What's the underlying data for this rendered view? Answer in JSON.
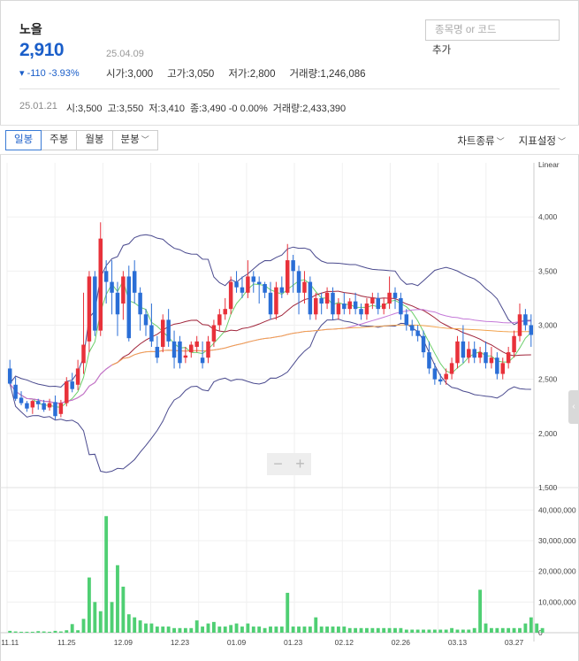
{
  "stock": {
    "name": "노을",
    "price": "2,910",
    "date": "25.04.09",
    "change": "▾ -110 -3.93%",
    "stats": [
      {
        "label": "시가",
        "value": "3,000"
      },
      {
        "label": "고가",
        "value": "3,050"
      },
      {
        "label": "저가",
        "value": "2,800"
      },
      {
        "label": "거래량",
        "value": "1,246,086"
      }
    ]
  },
  "search": {
    "placeholder": "종목명 or 코드",
    "add_label": "추가"
  },
  "previous": {
    "date": "25.01.21",
    "items": [
      {
        "label": "시",
        "value": "3,500"
      },
      {
        "label": "고",
        "value": "3,550"
      },
      {
        "label": "저",
        "value": "3,410"
      },
      {
        "label": "종",
        "value": "3,490 -0 0.00%"
      },
      {
        "label": "거래량",
        "value": "2,433,390"
      }
    ]
  },
  "toolbar": {
    "tabs": [
      "일봉",
      "주봉",
      "월봉",
      "분봉"
    ],
    "active_tab": 0,
    "chart_type_label": "차트종류",
    "indicator_label": "지표설정"
  },
  "colors": {
    "up": "#e8313a",
    "down": "#2a6ed6",
    "volume": "#4fcf73",
    "bollinger": "#4a4a8e",
    "ma_short": "#6bcf6b",
    "ma_mid": "#a0243a",
    "ma_long": "#c478d8",
    "ma_xlong": "#f2a24c"
  },
  "chart_data": {
    "type": "candlestick",
    "scale_label": "Linear",
    "price_ticks": [
      4000,
      3500,
      3000,
      2500,
      2000,
      1500
    ],
    "price_tick_labels": [
      "4,000",
      "3,500",
      "3,000",
      "2,500",
      "2,000",
      "1,500"
    ],
    "volume_ticks": [
      0,
      10000000,
      20000000,
      30000000,
      40000000
    ],
    "volume_tick_labels": [
      "0",
      "10,000,000",
      "20,000,000",
      "30,000,000",
      "40,000,000"
    ],
    "x_labels": [
      "11.11",
      "11.25",
      "12.09",
      "12.23",
      "01.09",
      "01.23",
      "02.12",
      "02.26",
      "03.13",
      "03.27"
    ],
    "x_label_index": [
      0,
      10,
      20,
      30,
      40,
      50,
      59,
      69,
      79,
      89
    ],
    "candles": [
      [
        2600,
        2680,
        2460,
        2450
      ],
      [
        2450,
        2520,
        2320,
        2300
      ],
      [
        2330,
        2390,
        2280,
        2260
      ],
      [
        2280,
        2300,
        2230,
        2200
      ],
      [
        2240,
        2310,
        2300,
        2180
      ],
      [
        2300,
        2320,
        2270,
        2220
      ],
      [
        2280,
        2310,
        2220,
        2200
      ],
      [
        2240,
        2320,
        2280,
        2210
      ],
      [
        2290,
        2350,
        2160,
        2130
      ],
      [
        2180,
        2310,
        2280,
        2150
      ],
      [
        2280,
        2520,
        2480,
        2250
      ],
      [
        2480,
        2560,
        2410,
        2380
      ],
      [
        2450,
        2680,
        2600,
        2400
      ],
      [
        2650,
        3300,
        2820,
        2550
      ],
      [
        2850,
        3500,
        3450,
        2750
      ],
      [
        3450,
        3500,
        2950,
        2900
      ],
      [
        2950,
        3950,
        3800,
        2900
      ],
      [
        3500,
        3600,
        3400,
        3200
      ],
      [
        3400,
        3600,
        3300,
        3100
      ],
      [
        3300,
        3400,
        3100,
        2900
      ],
      [
        3200,
        3500,
        3450,
        3050
      ],
      [
        3450,
        3550,
        2880,
        2850
      ],
      [
        3500,
        3600,
        3300,
        3200
      ],
      [
        3300,
        3350,
        3100,
        2950
      ],
      [
        3100,
        3150,
        3000,
        2900
      ],
      [
        3000,
        3200,
        2850,
        2800
      ],
      [
        2800,
        2900,
        2700,
        2650
      ],
      [
        2800,
        3100,
        3050,
        2750
      ],
      [
        3050,
        3150,
        2850,
        2800
      ],
      [
        2850,
        2950,
        2700,
        2600
      ],
      [
        2850,
        2900,
        2650,
        2600
      ],
      [
        2700,
        2800,
        2720,
        2650
      ],
      [
        2750,
        2850,
        2820,
        2700
      ],
      [
        2800,
        2900,
        2850,
        2750
      ],
      [
        2700,
        2850,
        2650,
        2600
      ],
      [
        2700,
        2900,
        2850,
        2650
      ],
      [
        2850,
        3050,
        3000,
        2800
      ],
      [
        3000,
        3150,
        3100,
        2950
      ],
      [
        3100,
        3250,
        3150,
        3050
      ],
      [
        3150,
        3450,
        3400,
        3100
      ],
      [
        3400,
        3500,
        3350,
        3300
      ],
      [
        3350,
        3450,
        3300,
        3250
      ],
      [
        3300,
        3600,
        3450,
        3250
      ],
      [
        3450,
        3500,
        3400,
        3300
      ],
      [
        3400,
        3450,
        3380,
        3200
      ],
      [
        3380,
        3400,
        3300,
        3250
      ],
      [
        3300,
        3400,
        3100,
        3050
      ],
      [
        3100,
        3400,
        3350,
        3050
      ],
      [
        3350,
        3450,
        3300,
        3250
      ],
      [
        3300,
        3750,
        3600,
        3280
      ],
      [
        3600,
        3650,
        3500,
        3300
      ],
      [
        3500,
        3550,
        3300,
        3100
      ],
      [
        3300,
        3500,
        3400,
        3200
      ],
      [
        3400,
        3450,
        3100,
        3050
      ],
      [
        3100,
        3300,
        3250,
        3050
      ],
      [
        3250,
        3300,
        3200,
        3100
      ],
      [
        3200,
        3350,
        3300,
        3150
      ],
      [
        3300,
        3350,
        3100,
        3050
      ],
      [
        3100,
        3250,
        3200,
        3050
      ],
      [
        3200,
        3300,
        3150,
        3100
      ],
      [
        3150,
        3250,
        3220,
        3100
      ],
      [
        3220,
        3300,
        3150,
        3100
      ],
      [
        3150,
        3200,
        3100,
        3050
      ],
      [
        3100,
        3250,
        3200,
        3050
      ],
      [
        3200,
        3300,
        3250,
        3150
      ],
      [
        3250,
        3300,
        3150,
        3100
      ],
      [
        3150,
        3250,
        3200,
        3100
      ],
      [
        3200,
        3450,
        3300,
        3150
      ],
      [
        3300,
        3350,
        3250,
        3150
      ],
      [
        3250,
        3300,
        3100,
        3050
      ],
      [
        3100,
        3150,
        3000,
        2950
      ],
      [
        3000,
        3050,
        2950,
        2900
      ],
      [
        2950,
        3000,
        2900,
        2850
      ],
      [
        2900,
        2950,
        2750,
        2700
      ],
      [
        2750,
        2850,
        2600,
        2550
      ],
      [
        2600,
        2650,
        2500,
        2450
      ],
      [
        2500,
        2550,
        2480,
        2450
      ],
      [
        2500,
        2600,
        2550,
        2450
      ],
      [
        2550,
        2700,
        2650,
        2500
      ],
      [
        2650,
        2900,
        2850,
        2600
      ],
      [
        2850,
        3000,
        2700,
        2650
      ],
      [
        2700,
        2850,
        2780,
        2650
      ],
      [
        2780,
        2850,
        2700,
        2650
      ],
      [
        2700,
        2800,
        2750,
        2650
      ],
      [
        2750,
        2850,
        2650,
        2600
      ],
      [
        2650,
        2800,
        2700,
        2600
      ],
      [
        2700,
        2750,
        2550,
        2500
      ],
      [
        2550,
        2700,
        2650,
        2500
      ],
      [
        2650,
        2800,
        2750,
        2600
      ],
      [
        2750,
        2950,
        2900,
        2700
      ],
      [
        2900,
        3200,
        3100,
        2850
      ],
      [
        3100,
        3150,
        3000,
        2950
      ],
      [
        3000,
        3100,
        2910,
        2800
      ]
    ],
    "volumes": [
      0.6,
      0.4,
      0.3,
      0.3,
      0.3,
      0.5,
      0.4,
      0.3,
      0.6,
      0.4,
      0.8,
      2.8,
      0.8,
      4.5,
      18,
      10,
      7,
      38,
      10,
      22,
      15,
      6,
      5,
      4,
      3,
      3,
      2,
      2,
      2,
      1.5,
      1.5,
      1.5,
      1.5,
      4,
      2,
      3,
      3.5,
      2,
      2,
      2.5,
      3,
      2,
      3,
      2,
      2,
      1.5,
      2,
      2,
      2,
      13,
      2,
      2,
      2,
      2,
      5,
      2,
      2,
      2,
      2,
      2,
      1.5,
      1.5,
      1.5,
      1.5,
      1.5,
      1.5,
      1.5,
      1.5,
      1.5,
      1.5,
      1,
      1,
      1,
      1,
      1,
      1,
      1,
      1,
      1.5,
      1,
      1,
      1,
      1.5,
      14,
      3,
      1.5,
      1.5,
      1.5,
      1.5,
      1.5,
      1.5,
      3,
      5,
      3,
      1.5
    ]
  }
}
